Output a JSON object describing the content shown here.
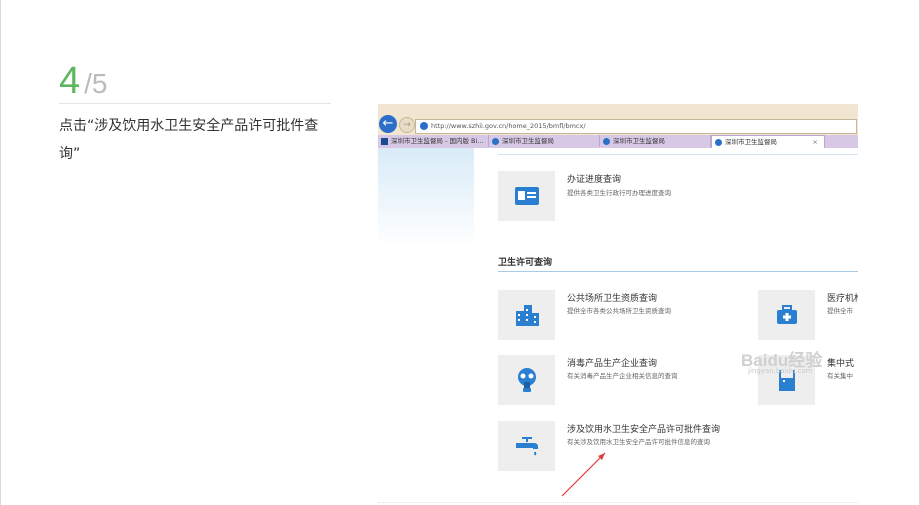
{
  "step": {
    "number": "4",
    "total": "/5",
    "text": "点击“涉及饮用水卫生安全产品许可批件查询”"
  },
  "browser": {
    "url": "http://www.szhii.gov.cn/home_2015/bmfl/bmcx/",
    "tabs": [
      {
        "label": "深圳市卫生监督局 - 国内版 Bi...",
        "icon": "bing-icon"
      },
      {
        "label": "深圳市卫生监督局",
        "icon": "ie-icon"
      },
      {
        "label": "深圳市卫生监督局",
        "icon": "ie-icon"
      },
      {
        "label": "深圳市卫生监督局",
        "icon": "ie-icon",
        "active": true
      }
    ]
  },
  "page": {
    "progress_item": {
      "title": "办证进度查询",
      "desc": "提供各类卫生行政行可办理进度查询"
    },
    "section_title": "卫生许可查询",
    "items": [
      {
        "title": "公共场所卫生资质查询",
        "desc": "提供全市各类公共场所卫生资质查询",
        "icon": "buildings-icon"
      },
      {
        "title": "医疗机构",
        "desc": "提供全市",
        "icon": "medical-kit-icon"
      },
      {
        "title": "消毒产品生产企业查询",
        "desc": "有关消毒产品生产企业相关信息的查询",
        "icon": "gas-mask-icon"
      },
      {
        "title": "集中式",
        "desc": "有关集中",
        "icon": "water-tank-icon"
      },
      {
        "title": "涉及饮用水卫生安全产品许可批件查询",
        "desc": "有关涉及饮用水卫生安全产品许可批件信息的查询",
        "icon": "faucet-icon"
      }
    ]
  },
  "watermark": {
    "text": "Baidu经验",
    "sub": "jingyan.baidu.com"
  },
  "colors": {
    "accent": "#5cb85c",
    "icon_blue": "#2b7fd0",
    "arrow": "#e23b3b"
  }
}
